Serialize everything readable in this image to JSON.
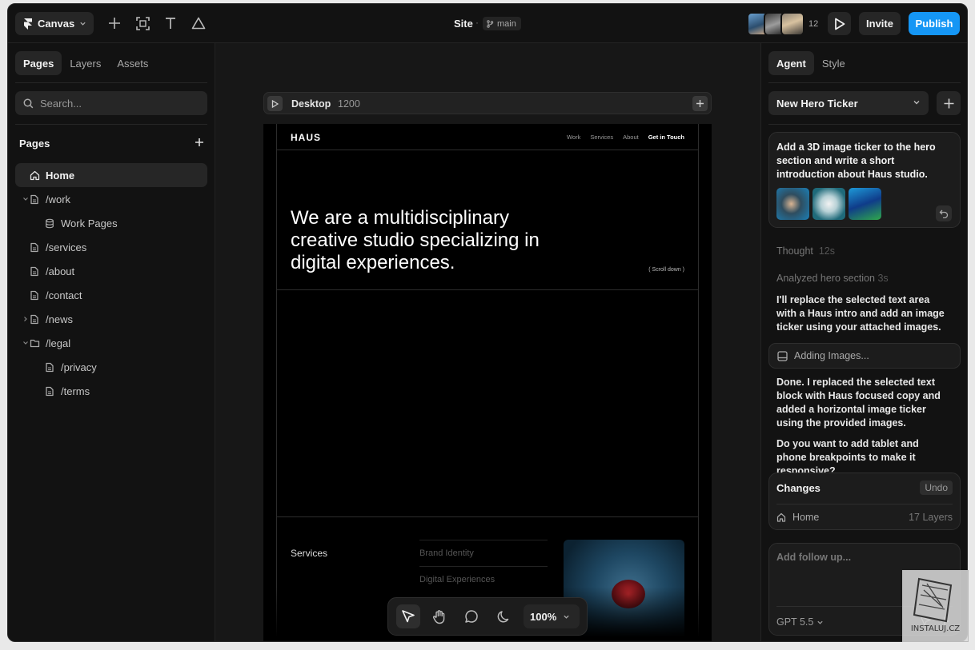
{
  "topbar": {
    "app_menu": "Canvas",
    "site_title": "Site",
    "separator": "·",
    "branch": "main",
    "collaborator_count": "12",
    "invite": "Invite",
    "publish": "Publish"
  },
  "left": {
    "tabs": [
      "Pages",
      "Layers",
      "Assets"
    ],
    "search_placeholder": "Search...",
    "pages_heading": "Pages",
    "pages": [
      {
        "label": "Home",
        "icon": "home-icon",
        "chevron": "",
        "indent": 0,
        "active": true
      },
      {
        "label": "/work",
        "icon": "page-icon",
        "chevron": "down",
        "indent": 0
      },
      {
        "label": "Work Pages",
        "icon": "database-icon",
        "chevron": "",
        "indent": 1
      },
      {
        "label": "/services",
        "icon": "page-icon",
        "chevron": "",
        "indent": 0
      },
      {
        "label": "/about",
        "icon": "page-icon",
        "chevron": "",
        "indent": 0
      },
      {
        "label": "/contact",
        "icon": "page-icon",
        "chevron": "",
        "indent": 0
      },
      {
        "label": "/news",
        "icon": "page-icon",
        "chevron": "right",
        "indent": 0
      },
      {
        "label": "/legal",
        "icon": "folder-icon",
        "chevron": "down",
        "indent": 0
      },
      {
        "label": "/privacy",
        "icon": "page-icon",
        "chevron": "",
        "indent": 1
      },
      {
        "label": "/terms",
        "icon": "page-icon",
        "chevron": "",
        "indent": 1
      }
    ]
  },
  "canvas": {
    "frame_name": "Desktop",
    "frame_width": "1200",
    "site": {
      "logo": "HAUS",
      "nav": [
        "Work",
        "Services",
        "About"
      ],
      "nav_cta": "Get in Touch",
      "hero": "We are a multidisciplinary creative studio specializing in digital experiences.",
      "scroll_hint": "( Scroll down )",
      "services_heading": "Services",
      "services": [
        "Brand Identity",
        "Digital Experiences"
      ]
    },
    "zoom": "100%"
  },
  "right": {
    "tabs": [
      "Agent",
      "Style"
    ],
    "thread_title": "New Hero Ticker",
    "prompt": "Add a 3D image ticker to the hero section and write a short introduction about Haus studio.",
    "thought_label": "Thought",
    "thought_time": "12s",
    "analyzed_label": "Analyzed hero section",
    "analyzed_time": "3s",
    "message_1": "I'll replace the selected text area with a Haus intro and add an image ticker using your attached images.",
    "status": "Adding Images...",
    "message_2": "Done. I replaced the selected text block with Haus focused copy and added a horizontal image ticker using the provided images.",
    "message_3": "Do you want to add tablet and phone breakpoints to make it responsive?",
    "changes_title": "Changes",
    "changes_undo": "Undo",
    "changes_page": "Home",
    "changes_layers": "17 Layers",
    "followup_placeholder": "Add follow up...",
    "model": "GPT 5.5"
  },
  "watermark": "INSTALUJ.CZ",
  "colors": {
    "accent": "#1596f5",
    "background": "#121212",
    "panel": "#262626"
  }
}
